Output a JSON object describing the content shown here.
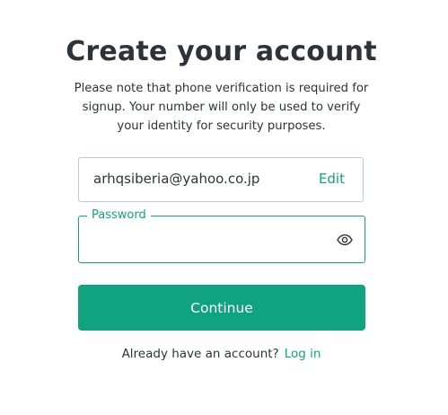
{
  "header": {
    "title": "Create your account",
    "subtitle": "Please note that phone verification is required for signup. Your number will only be used to verify your identity for security purposes."
  },
  "email": {
    "value": "arhqsiberia@yahoo.co.jp",
    "edit_label": "Edit"
  },
  "password": {
    "label": "Password",
    "value": "",
    "toggle_icon": "eye-icon"
  },
  "actions": {
    "continue_label": "Continue"
  },
  "footer": {
    "prompt": "Already have an account?",
    "login_label": "Log in"
  },
  "colors": {
    "accent": "#10a37f",
    "text": "#2d333a",
    "border": "#c2c8d0",
    "background": "#ffffff"
  }
}
